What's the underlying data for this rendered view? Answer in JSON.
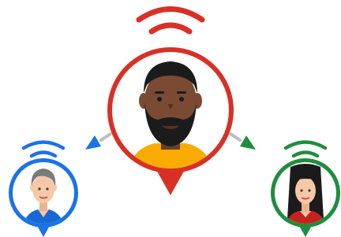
{
  "colors": {
    "red": "#d93025",
    "blue": "#1a73e8",
    "green": "#1e8e3e",
    "skin_dark": "#7b4a33",
    "skin_light": "#f6c8a6",
    "hair_black": "#1b1b1b",
    "hair_gray": "#7a7a7a",
    "shirt_yellow": "#f9ab00",
    "shirt_blue": "#1967d2",
    "shirt_red": "#c5221f",
    "arrow_gray": "#bdbdbd"
  },
  "pins": [
    {
      "role": "center",
      "color": "red",
      "person": "bearded-man"
    },
    {
      "role": "left",
      "color": "blue",
      "person": "gray-haired-man"
    },
    {
      "role": "right",
      "color": "green",
      "person": "woman"
    }
  ],
  "icons": [
    "wifi-signal-icon",
    "location-pin-icon",
    "arrow-icon"
  ]
}
